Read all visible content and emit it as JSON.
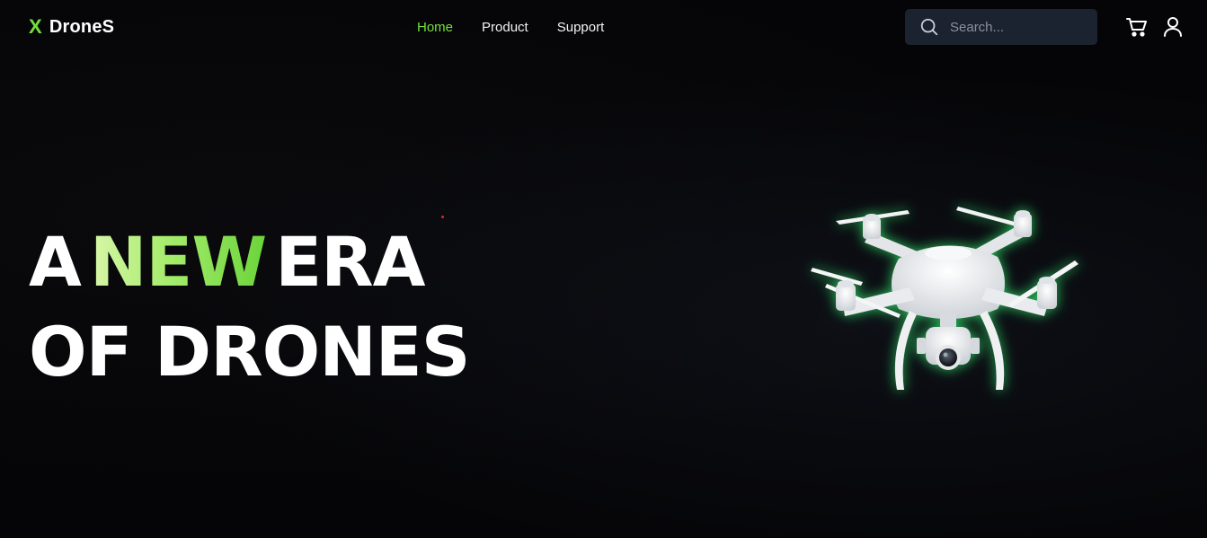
{
  "brand": {
    "mark": "X",
    "name": "DroneS"
  },
  "nav": {
    "items": [
      {
        "label": "Home",
        "active": true
      },
      {
        "label": "Product",
        "active": false
      },
      {
        "label": "Support",
        "active": false
      }
    ]
  },
  "search": {
    "placeholder": "Search...",
    "value": "",
    "icon": "search-icon"
  },
  "actions": {
    "cart_icon": "cart-icon",
    "user_icon": "user-icon"
  },
  "hero": {
    "line1_prefix": "A",
    "line1_highlight": "NEW",
    "line1_suffix": "ERA",
    "line2": "OF DRONES",
    "image": "drone-image"
  },
  "colors": {
    "accent": "#72e03c",
    "background": "#050507",
    "search_bg": "#1c2330",
    "text": "#ffffff"
  }
}
